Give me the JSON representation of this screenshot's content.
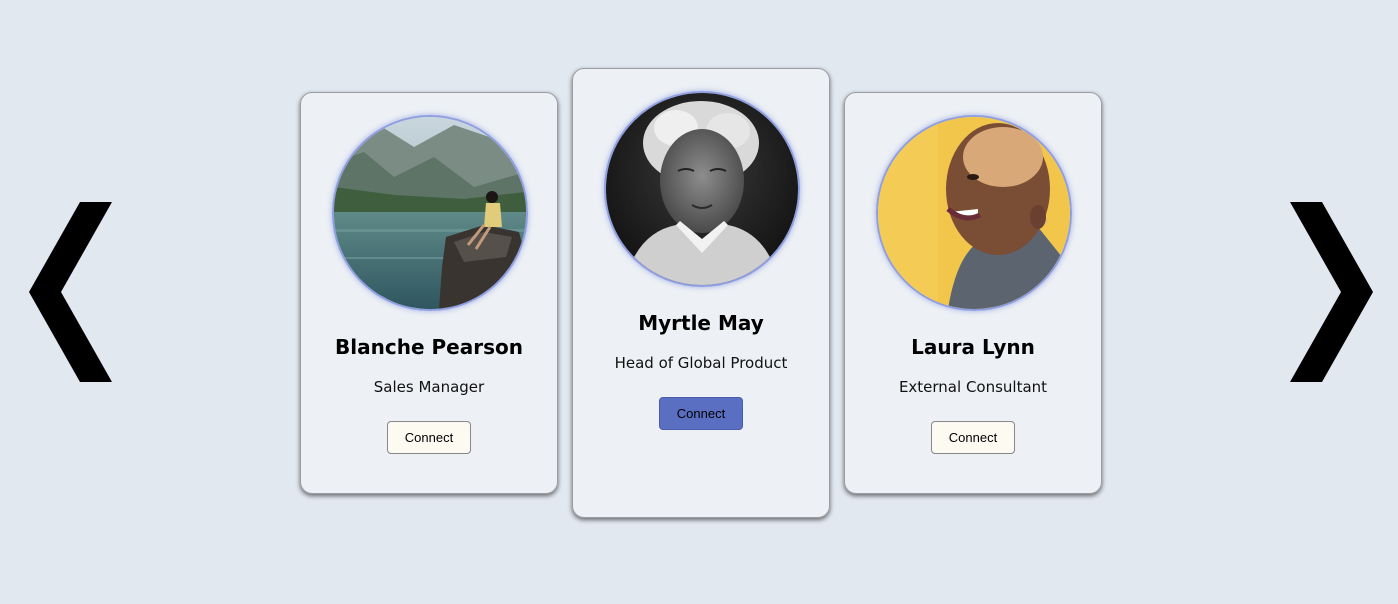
{
  "carousel": {
    "prev_icon": "chevron-left-icon",
    "next_icon": "chevron-right-icon",
    "cards": [
      {
        "name": "Blanche Pearson",
        "role": "Sales Manager",
        "connect_label": "Connect",
        "photo": "lake-woman-photo"
      },
      {
        "name": "Myrtle May",
        "role": "Head of Global Product",
        "connect_label": "Connect",
        "photo": "elderly-woman-photo",
        "active": true
      },
      {
        "name": "Laura Lynn",
        "role": "External Consultant",
        "connect_label": "Connect",
        "photo": "smiling-woman-photo"
      }
    ]
  },
  "colors": {
    "background": "#e2e8f0",
    "card": "#edf1f5",
    "primary_button": "#5b6fc2",
    "secondary_button": "#fdfaf2",
    "avatar_ring": "#8f9ee0"
  }
}
